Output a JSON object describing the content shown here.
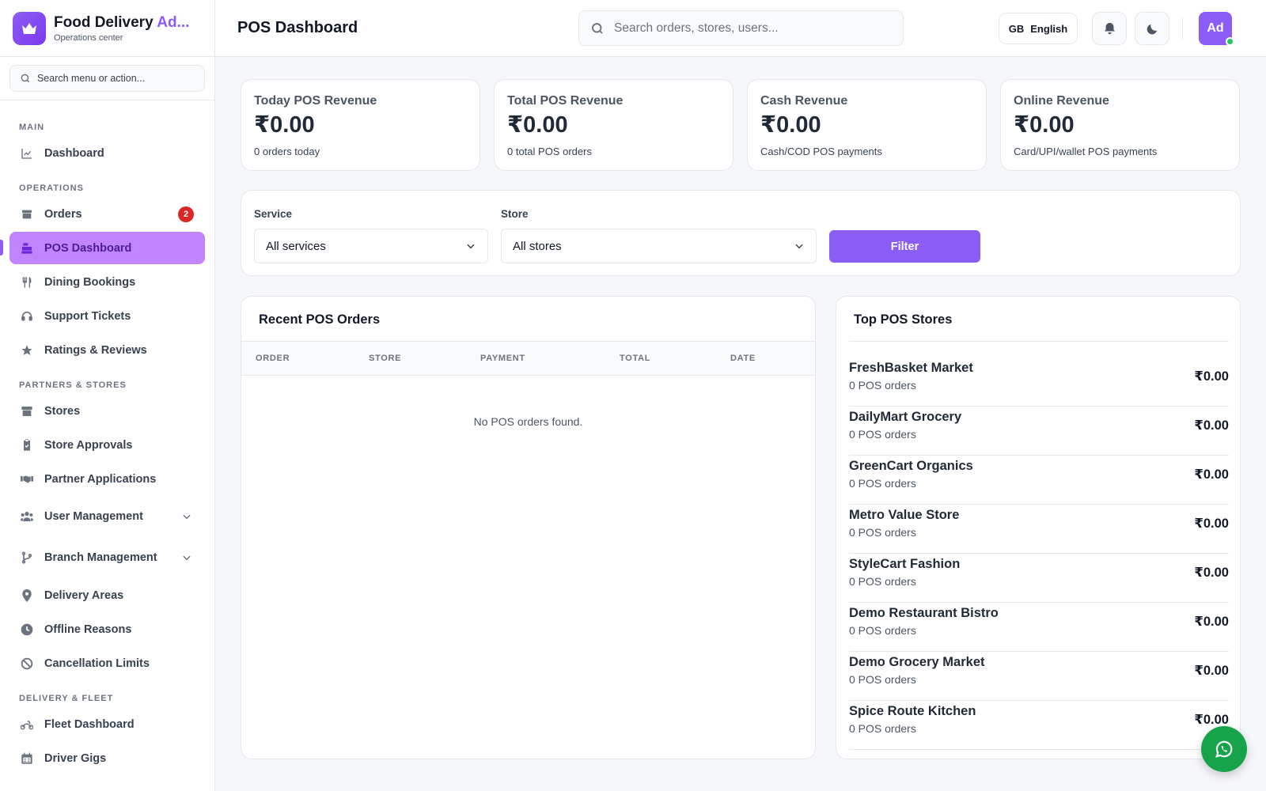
{
  "brand": {
    "title_main": "Food Delivery ",
    "title_accent": "Ad...",
    "subtitle": "Operations center",
    "logo_icon": "crown-icon"
  },
  "sidebar_search": {
    "placeholder": "Search menu or action..."
  },
  "nav": {
    "sections": {
      "main": "MAIN",
      "operations": "OPERATIONS",
      "partners": "PARTNERS & STORES",
      "delivery": "DELIVERY & FLEET"
    },
    "items": {
      "dashboard": "Dashboard",
      "orders": "Orders",
      "orders_badge": "2",
      "pos_dashboard": "POS Dashboard",
      "dining_bookings": "Dining Bookings",
      "support_tickets": "Support Tickets",
      "ratings_reviews": "Ratings & Reviews",
      "stores": "Stores",
      "store_approvals": "Store Approvals",
      "partner_applications": "Partner Applications",
      "user_management": "User Management",
      "branch_management": "Branch Management",
      "delivery_areas": "Delivery Areas",
      "offline_reasons": "Offline Reasons",
      "cancellation_limits": "Cancellation Limits",
      "fleet_dashboard": "Fleet Dashboard",
      "driver_gigs": "Driver Gigs"
    }
  },
  "header": {
    "title": "POS Dashboard",
    "search_placeholder": "Search orders, stores, users...",
    "language_flag": "GB",
    "language": "English",
    "avatar_initials": "Ad"
  },
  "stats": [
    {
      "title": "Today POS Revenue",
      "value": "₹0.00",
      "sub": "0 orders today"
    },
    {
      "title": "Total POS Revenue",
      "value": "₹0.00",
      "sub": "0 total POS orders"
    },
    {
      "title": "Cash Revenue",
      "value": "₹0.00",
      "sub": "Cash/COD POS payments"
    },
    {
      "title": "Online Revenue",
      "value": "₹0.00",
      "sub": "Card/UPI/wallet POS payments"
    }
  ],
  "filter": {
    "service_label": "Service",
    "service_value": "All services",
    "store_label": "Store",
    "store_value": "All stores",
    "button": "Filter"
  },
  "recent_orders": {
    "title": "Recent POS Orders",
    "columns": [
      "ORDER",
      "STORE",
      "PAYMENT",
      "TOTAL",
      "DATE"
    ],
    "empty": "No POS orders found."
  },
  "top_stores": {
    "title": "Top POS Stores",
    "items": [
      {
        "name": "FreshBasket Market",
        "orders": "0 POS orders",
        "value": "₹0.00"
      },
      {
        "name": "DailyMart Grocery",
        "orders": "0 POS orders",
        "value": "₹0.00"
      },
      {
        "name": "GreenCart Organics",
        "orders": "0 POS orders",
        "value": "₹0.00"
      },
      {
        "name": "Metro Value Store",
        "orders": "0 POS orders",
        "value": "₹0.00"
      },
      {
        "name": "StyleCart Fashion",
        "orders": "0 POS orders",
        "value": "₹0.00"
      },
      {
        "name": "Demo Restaurant Bistro",
        "orders": "0 POS orders",
        "value": "₹0.00"
      },
      {
        "name": "Demo Grocery Market",
        "orders": "0 POS orders",
        "value": "₹0.00"
      },
      {
        "name": "Spice Route Kitchen",
        "orders": "0 POS orders",
        "value": "₹0.00"
      }
    ]
  },
  "colors": {
    "accent": "#8b5cf6",
    "active_bg": "#c084fc",
    "badge": "#dc2626",
    "whatsapp": "#16a34a"
  }
}
